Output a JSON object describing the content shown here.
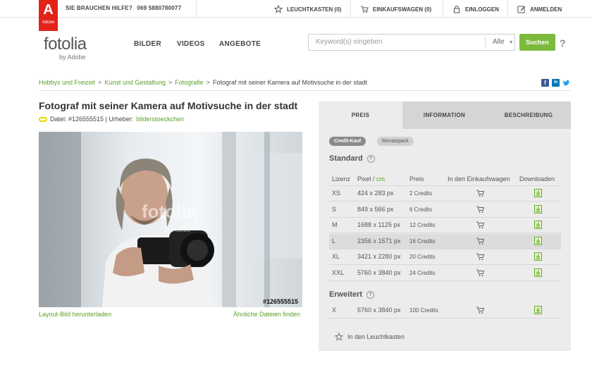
{
  "topbar": {
    "adobe_logo_letter": "A",
    "adobe_logo_text": "Adobe",
    "help_label": "SIE BRAUCHEN HILFE?",
    "help_phone": "069 5880780077",
    "lightbox_label": "LEUCHTKASTEN (0)",
    "cart_label": "EINKAUFSWAGEN (0)",
    "login_label": "EINLOGGEN",
    "register_label": "ANMELDEN"
  },
  "header": {
    "brand_name": "fotolia",
    "brand_by": "by Adobe",
    "nav": [
      "BILDER",
      "VIDEOS",
      "ANGEBOTE"
    ],
    "search_placeholder": "Keyword(s) eingeben",
    "search_filter": "Alle",
    "search_button": "Suchen",
    "help_question": "?"
  },
  "breadcrumb": {
    "items": [
      "Hobbys und Freizeit",
      "Kunst und Gestaltung",
      "Fotografie"
    ],
    "current": "Fotograf mit seiner Kamera auf Motivsuche in der stadt",
    "separator": ">"
  },
  "social": {
    "facebook": "f",
    "linkedin": "in",
    "twitter": "t"
  },
  "item": {
    "title": "Fotograf mit seiner Kamera auf Motivsuche in der stadt",
    "file_label": "Datei: #126555515 | Urheber:",
    "author": "bilderstoeckchen",
    "image_id": "#126555515",
    "watermark": "fotolia",
    "watermark_by": "by Adobe",
    "layout_link": "Layout-Bild herunterladen",
    "similar_link": "Ähnliche Dateien finden"
  },
  "panel": {
    "tabs": [
      "PREIS",
      "INFORMATION",
      "BESCHREIBUNG"
    ],
    "pills": [
      "Credit-Kauf",
      "Monatspack"
    ],
    "standard_label": "Standard",
    "extended_label": "Erweitert",
    "help_q": "?",
    "headers": {
      "license": "Lizenz",
      "pixel": "Pixel",
      "slash": " / ",
      "cm": "cm",
      "price": "Preis",
      "cart": "In den Einkaufswagen",
      "download": "Downloaden"
    },
    "standard_rows": [
      {
        "license": "XS",
        "size": "424 x 283 px",
        "price": "2 Credits"
      },
      {
        "license": "S",
        "size": "849 x 566 px",
        "price": "6 Credits"
      },
      {
        "license": "M",
        "size": "1688 x 1125 px",
        "price": "12 Credits"
      },
      {
        "license": "L",
        "size": "2356 x 1571 px",
        "price": "16 Credits"
      },
      {
        "license": "XL",
        "size": "3421 x 2280 px",
        "price": "20 Credits"
      },
      {
        "license": "XXL",
        "size": "5760 x 3840 px",
        "price": "24 Credits"
      }
    ],
    "extended_rows": [
      {
        "license": "X",
        "size": "5760 x 3840 px",
        "price": "100 Credits"
      }
    ],
    "lightbox_link": "In den Leuchtkasten"
  },
  "colors": {
    "brand_green": "#7cb93d",
    "link_green": "#5b9f29",
    "adobe_red": "#e2231a"
  }
}
